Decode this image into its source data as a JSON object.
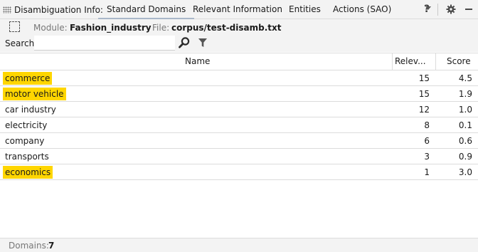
{
  "toolbar": {
    "view_title": "Disambiguation Info:",
    "tabs": [
      {
        "label": "Standard Domains",
        "active": true
      },
      {
        "label": "Relevant Information",
        "active": false
      },
      {
        "label": "Entities",
        "active": false
      },
      {
        "label": "Actions (SAO)",
        "active": false
      }
    ],
    "help_label": "?",
    "icons": [
      "grip-icon",
      "settings-icon",
      "minimize-icon"
    ]
  },
  "info": {
    "module_label": "Module:",
    "module_value": "Fashion_industry",
    "file_label": "File:",
    "file_value": "corpus/test-disamb.txt"
  },
  "search": {
    "label": "Search:",
    "value": "",
    "placeholder": ""
  },
  "table": {
    "headers": {
      "name": "Name",
      "relevance": "Relev...",
      "score": "Score"
    },
    "sorted_column": "relevance",
    "sort_direction": "descending",
    "highlight_color": "#ffd600",
    "rows": [
      {
        "name": "commerce",
        "relevance": "15",
        "score": "4.5",
        "highlighted": true
      },
      {
        "name": "motor vehicle",
        "relevance": "15",
        "score": "1.9",
        "highlighted": true
      },
      {
        "name": "car industry",
        "relevance": "12",
        "score": "1.0",
        "highlighted": false
      },
      {
        "name": "electricity",
        "relevance": "8",
        "score": "0.1",
        "highlighted": false
      },
      {
        "name": "company",
        "relevance": "6",
        "score": "0.6",
        "highlighted": false
      },
      {
        "name": "transports",
        "relevance": "3",
        "score": "0.9",
        "highlighted": false
      },
      {
        "name": "economics",
        "relevance": "1",
        "score": "3.0",
        "highlighted": true
      }
    ]
  },
  "footer": {
    "domains_label": "Domains:",
    "domains_count": "7"
  }
}
